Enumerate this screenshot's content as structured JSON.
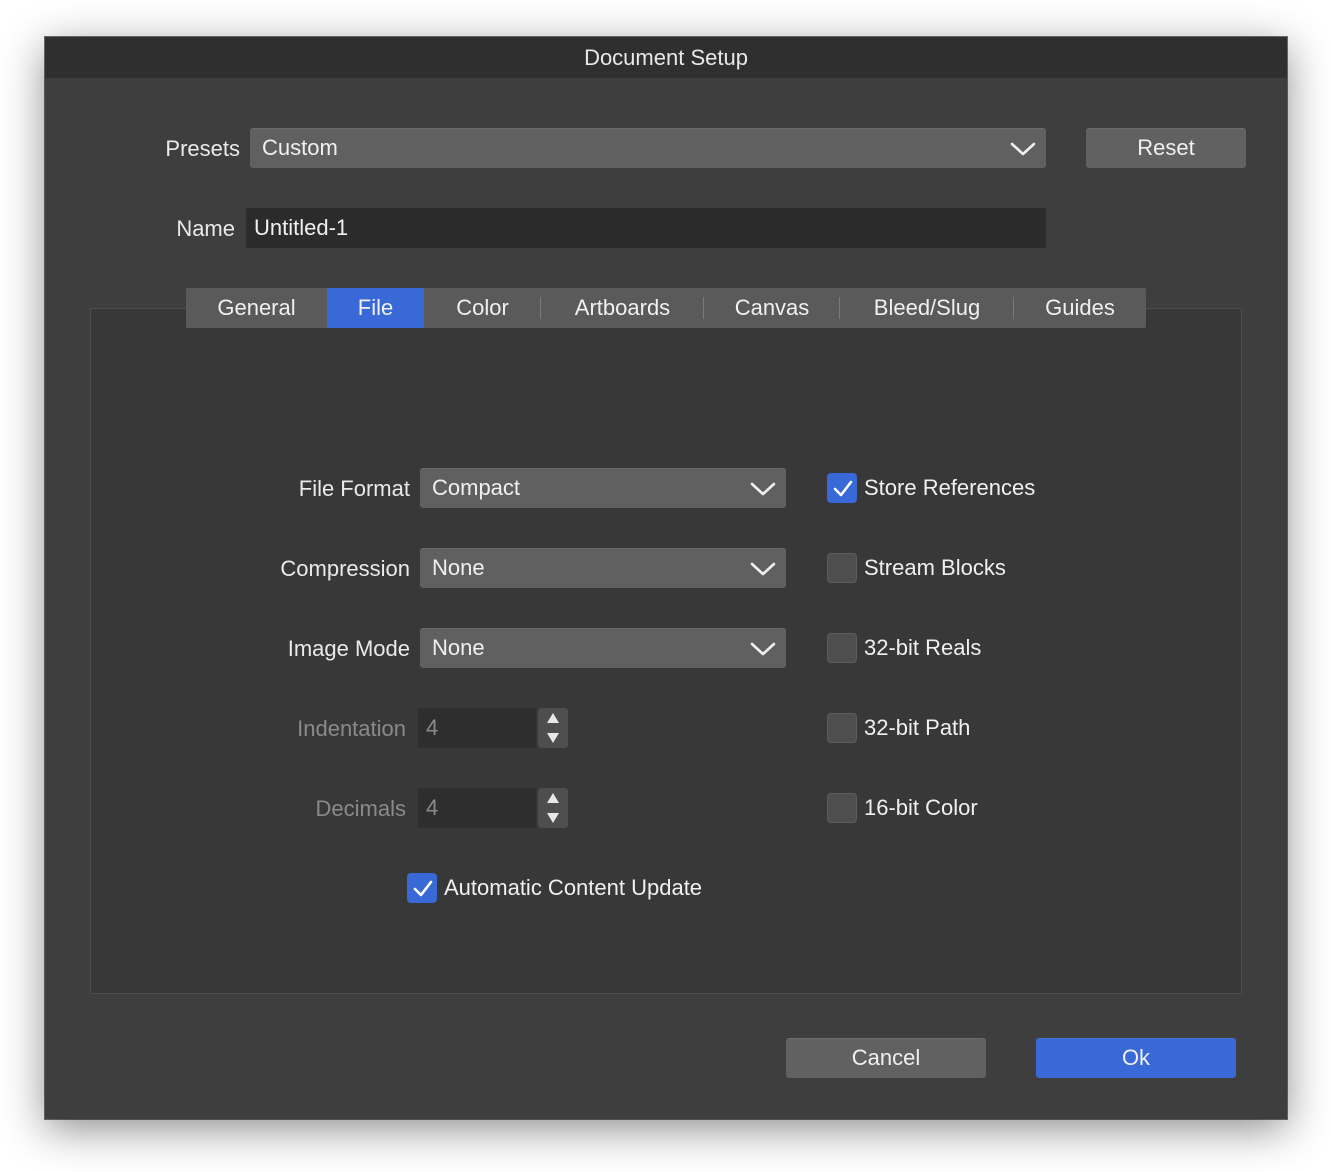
{
  "window": {
    "title": "Document Setup"
  },
  "presets": {
    "label": "Presets",
    "value": "Custom",
    "reset_label": "Reset"
  },
  "name": {
    "label": "Name",
    "value": "Untitled-1"
  },
  "tabs": [
    "General",
    "File",
    "Color",
    "Artboards",
    "Canvas",
    "Bleed/Slug",
    "Guides"
  ],
  "active_tab": "File",
  "file": {
    "file_format": {
      "label": "File Format",
      "value": "Compact"
    },
    "compression": {
      "label": "Compression",
      "value": "None"
    },
    "image_mode": {
      "label": "Image Mode",
      "value": "None"
    },
    "indentation": {
      "label": "Indentation",
      "value": "4"
    },
    "decimals": {
      "label": "Decimals",
      "value": "4"
    },
    "automatic_content_update": {
      "label": "Automatic Content Update",
      "checked": true
    },
    "store_references": {
      "label": "Store References",
      "checked": true
    },
    "stream_blocks": {
      "label": "Stream Blocks",
      "checked": false
    },
    "reals_32bit": {
      "label": "32-bit Reals",
      "checked": false
    },
    "path_32bit": {
      "label": "32-bit Path",
      "checked": false
    },
    "color_16bit": {
      "label": "16-bit Color",
      "checked": false
    }
  },
  "footer": {
    "cancel_label": "Cancel",
    "ok_label": "Ok"
  },
  "colors": {
    "accent": "#3869d6",
    "window_bg": "#3e3e3e",
    "panel_bg": "#383838"
  }
}
